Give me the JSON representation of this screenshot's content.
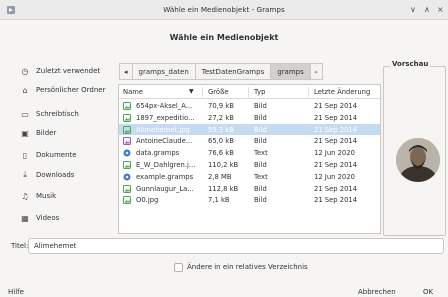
{
  "window": {
    "title": "Wähle ein Medienobjekt - Gramps",
    "minimize": "∨",
    "maximize": "∧",
    "close": "×"
  },
  "dialog": {
    "heading": "Wähle ein Medienobjekt"
  },
  "places": [
    {
      "icon": "clock-icon",
      "glyph": "◷",
      "label": "Zuletzt verwendet"
    },
    {
      "icon": "home-icon",
      "glyph": "⌂",
      "label": "Persönlicher Ordner"
    },
    {
      "icon": "folder-icon",
      "glyph": "▭",
      "label": "Schreibtisch"
    },
    {
      "icon": "image-folder-icon",
      "glyph": "▣",
      "label": "Bilder"
    },
    {
      "icon": "document-icon",
      "glyph": "▯",
      "label": "Dokumente"
    },
    {
      "icon": "download-icon",
      "glyph": "⤓",
      "label": "Downloads"
    },
    {
      "icon": "music-icon",
      "glyph": "♫",
      "label": "Musik"
    },
    {
      "icon": "video-icon",
      "glyph": "▦",
      "label": "Videos"
    }
  ],
  "pathbar": {
    "back": "◂",
    "crumbs": [
      "gramps_daten",
      "TestDatenGramps",
      "gramps"
    ],
    "active_index": 2,
    "forward": "▸"
  },
  "filelist": {
    "columns": {
      "name": "Name",
      "sort_indicator": "▼",
      "size": "Größe",
      "type": "Typ",
      "date": "Letzte Änderung"
    },
    "rows": [
      {
        "kind": "image",
        "name": "654px-Aksel_A...",
        "size": "70,9 kB",
        "type": "Bild",
        "date": "21 Sep 2014",
        "selected": false
      },
      {
        "kind": "image",
        "name": "1897_expeditio...",
        "size": "27,2 kB",
        "type": "Bild",
        "date": "21 Sep 2014",
        "selected": false
      },
      {
        "kind": "image",
        "name": "Alimehemet.jpg",
        "size": "59,3 kB",
        "type": "Bild",
        "date": "21 Sep 2014",
        "selected": true
      },
      {
        "kind": "image-alt",
        "name": "AntoineClaude...",
        "size": "65,0 kB",
        "type": "Bild",
        "date": "21 Sep 2014",
        "selected": false
      },
      {
        "kind": "text",
        "name": "data.gramps",
        "size": "76,6 kB",
        "type": "Text",
        "date": "12 Jun 2020",
        "selected": false
      },
      {
        "kind": "image",
        "name": "E_W_Dahlgren.j...",
        "size": "110,2 kB",
        "type": "Bild",
        "date": "21 Sep 2014",
        "selected": false
      },
      {
        "kind": "text",
        "name": "example.gramps",
        "size": "2,8 MB",
        "type": "Text",
        "date": "12 Jun 2020",
        "selected": false
      },
      {
        "kind": "image",
        "name": "Gunnlaugur_La...",
        "size": "112,8 kB",
        "type": "Bild",
        "date": "21 Sep 2014",
        "selected": false
      },
      {
        "kind": "image",
        "name": "O0.jpg",
        "size": "7,1 kB",
        "type": "Bild",
        "date": "21 Sep 2014",
        "selected": false
      }
    ]
  },
  "preview": {
    "label": "Vorschau"
  },
  "title_field": {
    "label": "Titel:",
    "value": "Alimehemet"
  },
  "relative_path": {
    "label": "Ändere in ein relatives Verzeichnis",
    "checked": false
  },
  "buttons": {
    "help": "Hilfe",
    "cancel": "Abbrechen",
    "ok": "OK"
  },
  "colors": {
    "selection": "#c4dbf2",
    "window_bg": "#f6f5f4",
    "image_icon": "#4fa84f",
    "text_icon": "#3a7bd5"
  }
}
